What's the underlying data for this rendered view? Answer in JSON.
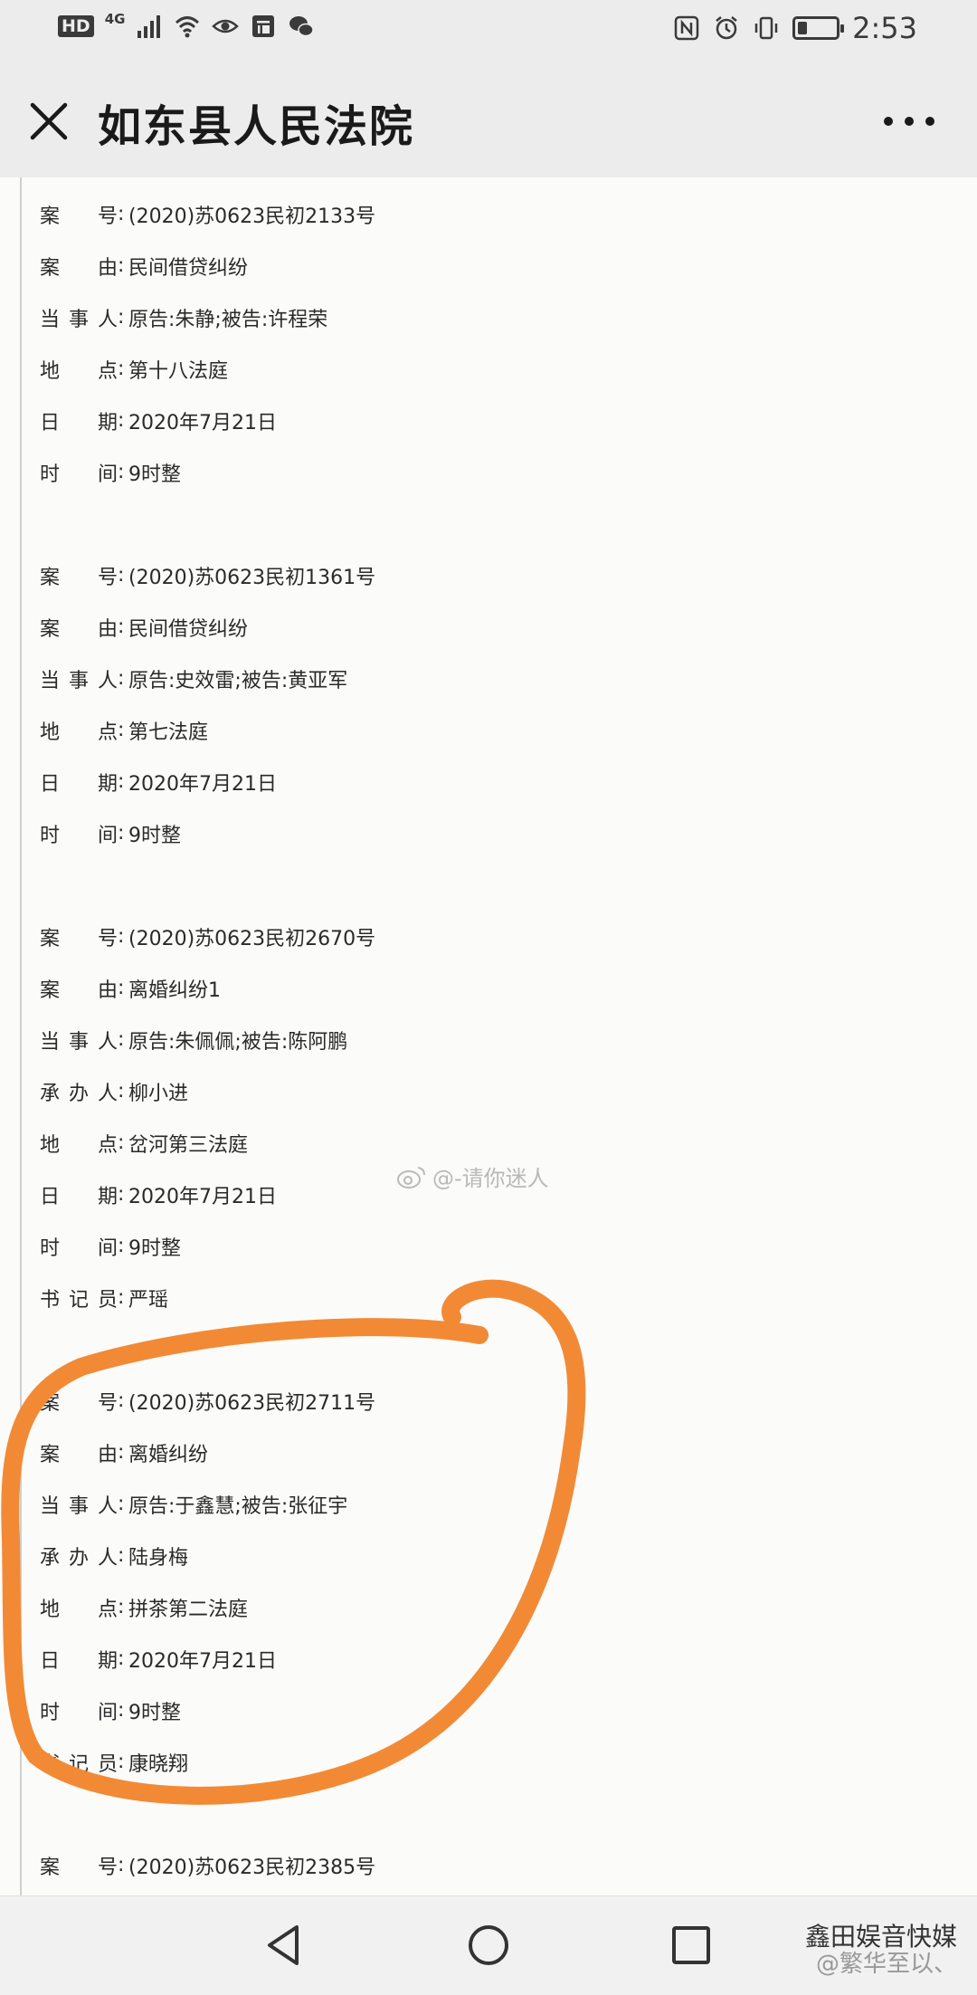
{
  "status_bar": {
    "left_badges": [
      "HD",
      "4G"
    ],
    "time": "2:53",
    "battery_level": 0.25,
    "icons": [
      "signal-icon",
      "wifi-icon",
      "eye-icon",
      "store-icon",
      "wechat-icon",
      "nfc-icon",
      "alarm-icon",
      "vibrate-icon",
      "battery-icon"
    ]
  },
  "app_bar": {
    "title": "如东县人民法院",
    "close_icon": "close-icon",
    "more_icon": "more-icon"
  },
  "cases": [
    {
      "fields": [
        {
          "label": "案 号",
          "value": "(2020)苏0623民初2133号"
        },
        {
          "label": "案 由",
          "value": "民间借贷纠纷"
        },
        {
          "label": "当事人",
          "value": "原告:朱静;被告:许程荣"
        },
        {
          "label": "地 点",
          "value": "第十八法庭"
        },
        {
          "label": "日 期",
          "value": "2020年7月21日"
        },
        {
          "label": "时 间",
          "value": "9时整"
        }
      ]
    },
    {
      "fields": [
        {
          "label": "案 号",
          "value": "(2020)苏0623民初1361号"
        },
        {
          "label": "案 由",
          "value": "民间借贷纠纷"
        },
        {
          "label": "当事人",
          "value": "原告:史效雷;被告:黄亚军"
        },
        {
          "label": "地 点",
          "value": "第七法庭"
        },
        {
          "label": "日 期",
          "value": "2020年7月21日"
        },
        {
          "label": "时 间",
          "value": "9时整"
        }
      ]
    },
    {
      "fields": [
        {
          "label": "案 号",
          "value": "(2020)苏0623民初2670号"
        },
        {
          "label": "案 由",
          "value": "离婚纠纷1"
        },
        {
          "label": "当事人",
          "value": "原告:朱佩佩;被告:陈阿鹏"
        },
        {
          "label": "承办人",
          "value": "柳小进"
        },
        {
          "label": "地 点",
          "value": "岔河第三法庭"
        },
        {
          "label": "日 期",
          "value": "2020年7月21日"
        },
        {
          "label": "时 间",
          "value": "9时整"
        },
        {
          "label": "书记员",
          "value": "严瑶"
        }
      ]
    },
    {
      "fields": [
        {
          "label": "案 号",
          "value": "(2020)苏0623民初2711号"
        },
        {
          "label": "案 由",
          "value": "离婚纠纷"
        },
        {
          "label": "当事人",
          "value": "原告:于鑫慧;被告:张征宇"
        },
        {
          "label": "承办人",
          "value": "陆身梅"
        },
        {
          "label": "地 点",
          "value": "拼茶第二法庭"
        },
        {
          "label": "日 期",
          "value": "2020年7月21日"
        },
        {
          "label": "时 间",
          "value": "9时整"
        },
        {
          "label": "书记员",
          "value": "康晓翔"
        }
      ]
    },
    {
      "fields": [
        {
          "label": "案 号",
          "value": "(2020)苏0623民初2385号"
        }
      ]
    }
  ],
  "watermark": {
    "text": "@-请你迷人"
  },
  "footer_watermark": {
    "line1": "鑫田娱音快媒",
    "line2": "@繁华至以、"
  },
  "annotation_color": "#f28a35"
}
